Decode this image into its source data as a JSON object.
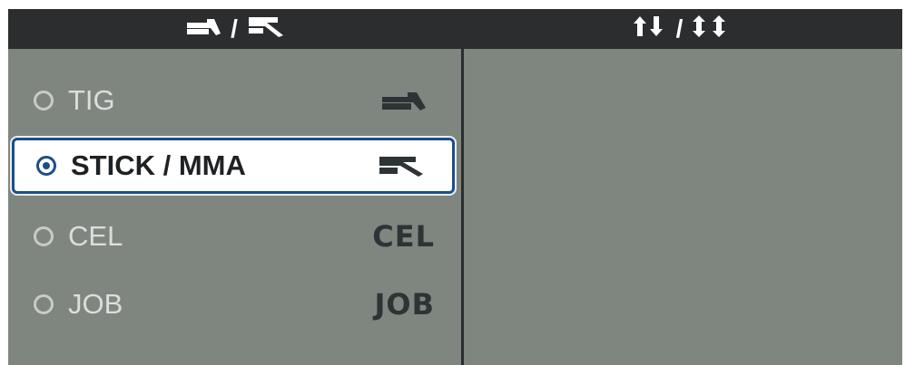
{
  "header": {
    "left": {
      "icon_a": "tig-torch-icon",
      "separator": "/",
      "icon_b": "stick-electrode-icon"
    },
    "right": {
      "icon_a": "two-step-trigger-icon",
      "separator": "/",
      "icon_b": "four-step-trigger-icon"
    }
  },
  "process_list": {
    "items": [
      {
        "label": "TIG",
        "icon": "tig-torch-icon",
        "selected": false
      },
      {
        "label": "STICK / MMA",
        "icon": "stick-electrode-icon",
        "selected": true
      },
      {
        "label": "CEL",
        "badge": "CEL",
        "selected": false
      },
      {
        "label": "JOB",
        "badge": "JOB",
        "selected": false
      }
    ]
  },
  "colors": {
    "panel_bg": "#7f8680",
    "header_bg": "#2b2d2e",
    "selection_border": "#1d4f86",
    "selected_bg": "#ffffff"
  }
}
